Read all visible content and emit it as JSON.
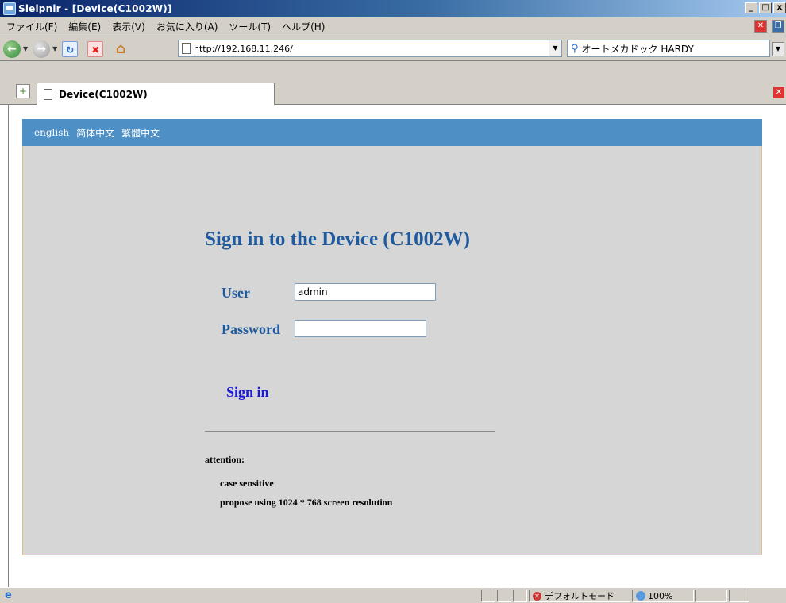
{
  "window": {
    "title": "Sleipnir - [Device(C1002W)]",
    "min": "_",
    "max": "□",
    "close": "x"
  },
  "menu": [
    "ファイル(F)",
    "編集(E)",
    "表示(V)",
    "お気に入り(A)",
    "ツール(T)",
    "ヘルプ(H)"
  ],
  "toolbar": {
    "address": "http://192.168.11.246/",
    "search": "オートメカドック HARDY"
  },
  "tab": {
    "title": "Device(C1002W)"
  },
  "page": {
    "languages": [
      "english",
      "简体中文",
      "繁體中文"
    ],
    "heading": "Sign in to the Device (C1002W)",
    "user_label": "User",
    "user_value": "admin",
    "password_label": "Password",
    "password_value": "",
    "signin_label": "Sign in",
    "attention_label": "attention:",
    "notes": [
      "case sensitive",
      "propose using 1024 * 768 screen resolution"
    ]
  },
  "status": {
    "mode": "デフォルトモード",
    "zoom": "100%"
  },
  "colors": {
    "lang_bar": "#4e8fc5",
    "panel": "#d6d6d6",
    "heading": "#1f5a9e",
    "signin": "#1c1cd6"
  }
}
